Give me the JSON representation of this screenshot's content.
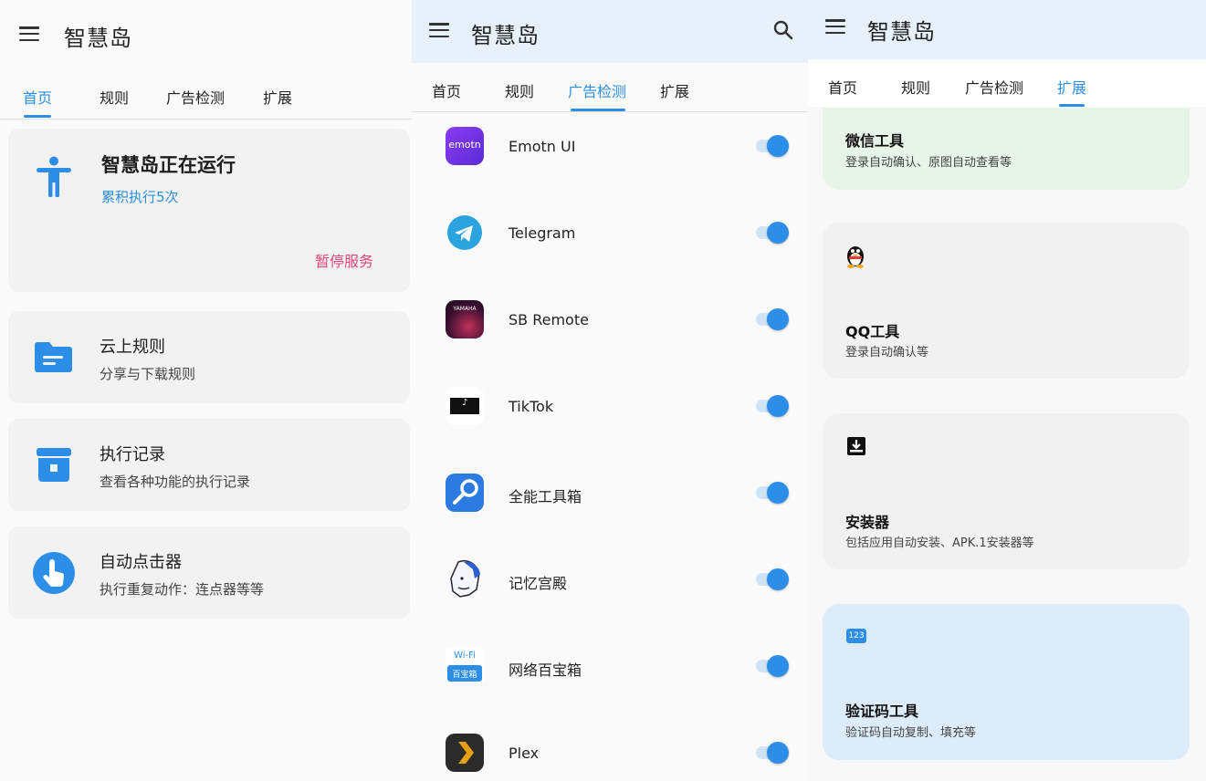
{
  "app_title": "智慧岛",
  "tabs": [
    "首页",
    "规则",
    "广告检测",
    "扩展"
  ],
  "home": {
    "status_title": "智慧岛正在运行",
    "status_sub": "累积执行5次",
    "pause_label": "暂停服务",
    "items": [
      {
        "title": "云上规则",
        "sub": "分享与下载规则",
        "icon": "folder-icon"
      },
      {
        "title": "执行记录",
        "sub": "查看各种功能的执行记录",
        "icon": "archive-icon"
      },
      {
        "title": "自动点击器",
        "sub": "执行重复动作：连点器等等",
        "icon": "tap-icon"
      }
    ]
  },
  "ads": {
    "apps": [
      {
        "name": "Emotn UI",
        "icon_text": "emotn",
        "enabled": true
      },
      {
        "name": "Telegram",
        "enabled": true
      },
      {
        "name": "SB Remote",
        "icon_text": "YAMAHA",
        "enabled": true
      },
      {
        "name": "TikTok",
        "enabled": true
      },
      {
        "name": "全能工具箱",
        "enabled": true
      },
      {
        "name": "记忆宫殿",
        "enabled": true
      },
      {
        "name": "网络百宝箱",
        "icon_text": [
          "Wi-Fi",
          "百宝箱"
        ],
        "enabled": true
      },
      {
        "name": "Plex",
        "enabled": true
      }
    ]
  },
  "ext": {
    "cards": [
      {
        "title": "微信工具",
        "sub": "登录自动确认、原图自动查看等",
        "icon": "wechat-icon"
      },
      {
        "title": "QQ工具",
        "sub": "登录自动确认等",
        "icon": "qq-penguin-icon"
      },
      {
        "title": "安装器",
        "sub": "包括应用自动安装、APK.1安装器等",
        "icon": "installer-icon"
      },
      {
        "title": "验证码工具",
        "sub": "验证码自动复制、填充等",
        "icon": "code-123-icon",
        "icon_text": "123"
      }
    ]
  },
  "colors": {
    "accent": "#2c8ee6",
    "pause": "#e2467a",
    "wechat_card": "#e6f5e8",
    "code_card": "#dcecfb"
  }
}
